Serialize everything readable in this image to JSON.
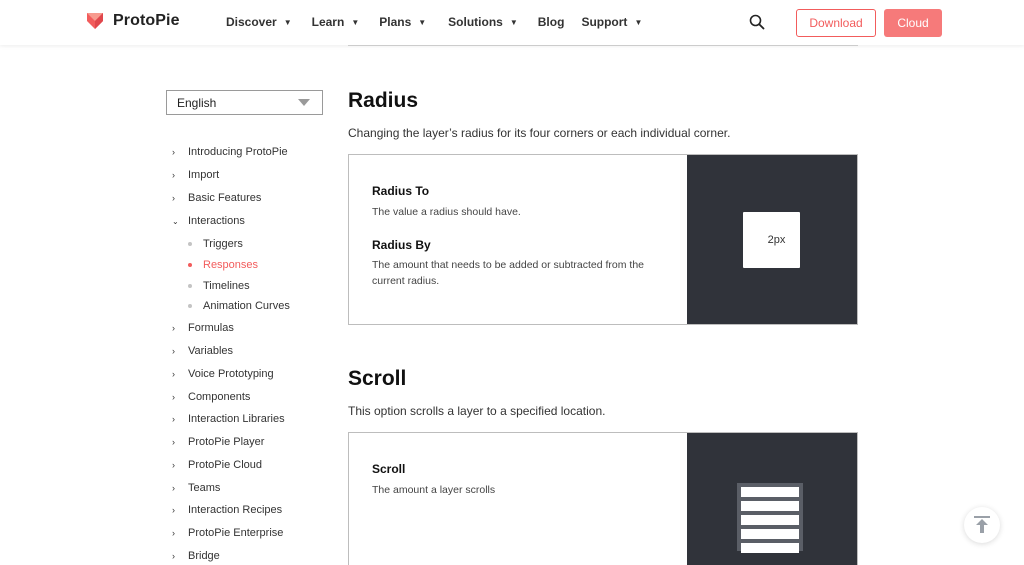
{
  "brand": {
    "name": "ProtoPie",
    "color": "#f25c5c"
  },
  "nav": {
    "items": [
      {
        "label": "Discover",
        "dropdown": true
      },
      {
        "label": "Learn",
        "dropdown": true
      },
      {
        "label": "Plans",
        "dropdown": true
      },
      {
        "label": "Solutions",
        "dropdown": true
      },
      {
        "label": "Blog",
        "dropdown": false
      },
      {
        "label": "Support",
        "dropdown": true
      }
    ],
    "search_icon": "search-icon",
    "download_label": "Download",
    "cloud_label": "Cloud"
  },
  "sidebar": {
    "language": "English",
    "items": [
      {
        "label": "Introducing ProtoPie",
        "expanded": false
      },
      {
        "label": "Import",
        "expanded": false
      },
      {
        "label": "Basic Features",
        "expanded": false
      },
      {
        "label": "Interactions",
        "expanded": true
      },
      {
        "label": "Formulas",
        "expanded": false
      },
      {
        "label": "Variables",
        "expanded": false
      },
      {
        "label": "Voice Prototyping",
        "expanded": false
      },
      {
        "label": "Components",
        "expanded": false
      },
      {
        "label": "Interaction Libraries",
        "expanded": false
      },
      {
        "label": "ProtoPie Player",
        "expanded": false
      },
      {
        "label": "ProtoPie Cloud",
        "expanded": false
      },
      {
        "label": "Teams",
        "expanded": false
      },
      {
        "label": "Interaction Recipes",
        "expanded": false
      },
      {
        "label": "ProtoPie Enterprise",
        "expanded": false
      },
      {
        "label": "Bridge",
        "expanded": false
      }
    ],
    "sub_items": [
      {
        "label": "Triggers",
        "active": false
      },
      {
        "label": "Responses",
        "active": true
      },
      {
        "label": "Timelines",
        "active": false
      },
      {
        "label": "Animation Curves",
        "active": false
      }
    ]
  },
  "sections": {
    "radius": {
      "title": "Radius",
      "description": "Changing the layer’s radius for its four corners or each individual corner.",
      "props": [
        {
          "name": "Radius To",
          "desc": "The value a radius should have."
        },
        {
          "name": "Radius By",
          "desc": "The amount that needs to be added or subtracted from the current radius."
        }
      ],
      "preview_value": "2px"
    },
    "scroll": {
      "title": "Scroll",
      "description": "This option scrolls a layer to a specified location.",
      "props": [
        {
          "name": "Scroll",
          "desc": "The amount a layer scrolls"
        }
      ]
    }
  }
}
